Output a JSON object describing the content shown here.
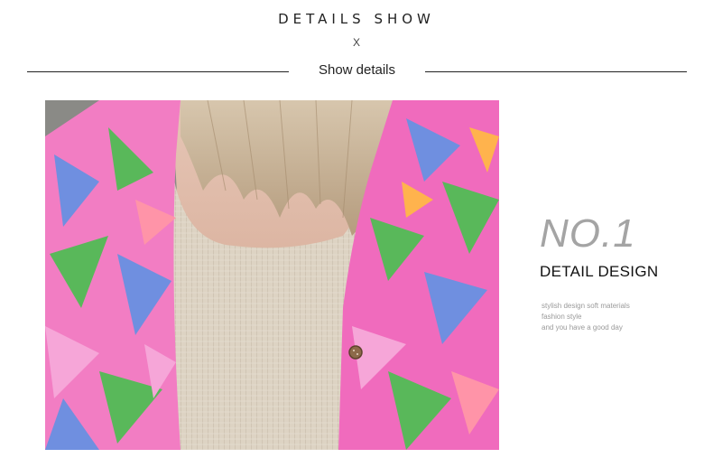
{
  "header": {
    "title": "DETAILS SHOW",
    "close_glyph": "X",
    "subtitle": "Show details"
  },
  "photo": {
    "subject": "floral print open-front cardigan over ribbed cream tank top",
    "colors": {
      "pink": "#f06bbd",
      "blue": "#6f8fe0",
      "green": "#59b85a",
      "cream": "#ddd3c3",
      "hair": "#c8b49b",
      "backdrop": "#8a8a86"
    }
  },
  "feature": {
    "number": "NO.1",
    "heading": "DETAIL DESIGN",
    "lines": [
      "stylish design soft materials",
      "fashion style",
      "and you have a good day"
    ]
  }
}
